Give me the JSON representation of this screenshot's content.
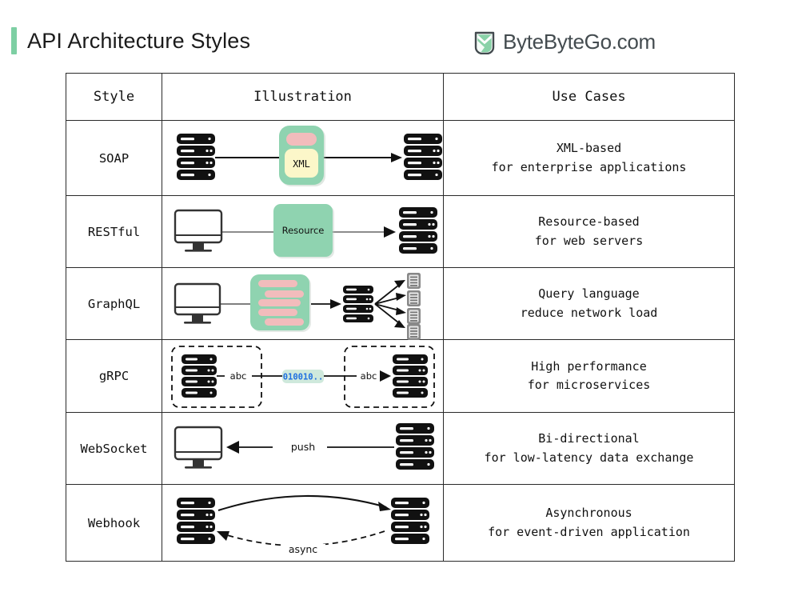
{
  "header": {
    "title": "API Architecture Styles",
    "accent_color": "#7dcfa3",
    "brand_name": "ByteByteGo.com",
    "brand_icon": "bytebytego-leaf-icon"
  },
  "table": {
    "columns": [
      "Style",
      "Illustration",
      "Use Cases"
    ],
    "rows": [
      {
        "style": "SOAP",
        "use_line1": "XML-based",
        "use_line2": "for enterprise applications",
        "illustration": {
          "kind": "server-envelope-server",
          "nodes": [
            "server-icon",
            "xml-envelope",
            "server-icon"
          ],
          "badge_label": "XML",
          "arrow": "solid-right"
        }
      },
      {
        "style": "RESTful",
        "use_line1": "Resource-based",
        "use_line2": "for web servers",
        "illustration": {
          "kind": "client-resource-server",
          "nodes": [
            "monitor-icon",
            "resource-box",
            "server-icon"
          ],
          "badge_label": "Resource",
          "arrow": "solid-right"
        }
      },
      {
        "style": "GraphQL",
        "use_line1": "Query language",
        "use_line2": "reduce network load",
        "illustration": {
          "kind": "client-query-fanout",
          "nodes": [
            "monitor-icon",
            "query-box",
            "server-icon",
            "database-icon"
          ],
          "fanout_count": 4,
          "query_bars": 5,
          "arrow": "solid-right"
        }
      },
      {
        "style": "gRPC",
        "use_line1": "High performance",
        "use_line2": "for microservices",
        "illustration": {
          "kind": "stub-binary-stub",
          "nodes": [
            "server-icon",
            "server-icon"
          ],
          "left_label": "abc",
          "right_label": "abc",
          "binary_label": "010010..",
          "arrow": "solid-right"
        }
      },
      {
        "style": "WebSocket",
        "use_line1": "Bi-directional",
        "use_line2": "for low-latency data exchange",
        "illustration": {
          "kind": "server-push-client",
          "nodes": [
            "monitor-icon",
            "server-icon"
          ],
          "arrow_label": "push",
          "arrow": "solid-left"
        }
      },
      {
        "style": "Webhook",
        "use_line1": "Asynchronous",
        "use_line2": "for event-driven application",
        "illustration": {
          "kind": "server-callback-server",
          "nodes": [
            "server-icon",
            "server-icon"
          ],
          "arrow_label": "async",
          "arrow": "curved-solid-right-and-dashed-left"
        }
      }
    ]
  },
  "colors": {
    "accent_green": "#7dcfa3",
    "panel_green": "#8fd3b0",
    "pink": "#f2bcbc",
    "cream": "#fcf7c9",
    "binary_blue": "#1f6fe0",
    "binary_bg": "#cfe9dc",
    "border": "#2a2a2a",
    "ink": "#111111",
    "brand_text": "#434b4f"
  }
}
